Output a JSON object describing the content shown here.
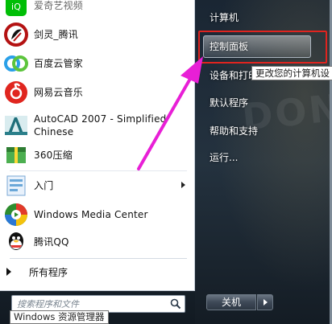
{
  "programs": [
    {
      "label": "爱奇艺视频",
      "icon": "iqiyi-icon",
      "color": "#00be06"
    },
    {
      "label": "剑灵_腾讯",
      "icon": "blade-soul-icon",
      "color": "#c21010"
    },
    {
      "label": "百度云管家",
      "icon": "baidu-cloud-icon",
      "color": "#2aa0e8"
    },
    {
      "label": "网易云音乐",
      "icon": "netease-music-icon",
      "color": "#e0261f"
    },
    {
      "label": "AutoCAD 2007 - Simplified",
      "label2": "Chinese",
      "icon": "autocad-icon",
      "color": "#2a7f8a"
    },
    {
      "label": "360压缩",
      "icon": "360zip-icon",
      "color": "#3a8e2f"
    },
    {
      "label": "入门",
      "icon": "getting-started-icon",
      "color": "#6aa7d8"
    },
    {
      "label": "Windows Media Center",
      "icon": "media-center-icon",
      "color": "#2d8d2d"
    },
    {
      "label": "腾讯QQ",
      "icon": "qq-icon",
      "color": "#111111"
    }
  ],
  "all_programs": "所有程序",
  "search": {
    "placeholder": "搜索程序和文件"
  },
  "explorer_tooltip": "Windows 资源管理器",
  "right_items": {
    "computer": "计算机",
    "control_panel": "控制面板",
    "devices_printers": "设备和打印",
    "default_programs": "默认程序",
    "help_support": "帮助和支持",
    "run": "运行..."
  },
  "control_panel_tooltip": "更改您的计算机设",
  "shutdown": "关机",
  "colors": {
    "highlight": "#e0241f",
    "arrow": "#e81fd6"
  }
}
